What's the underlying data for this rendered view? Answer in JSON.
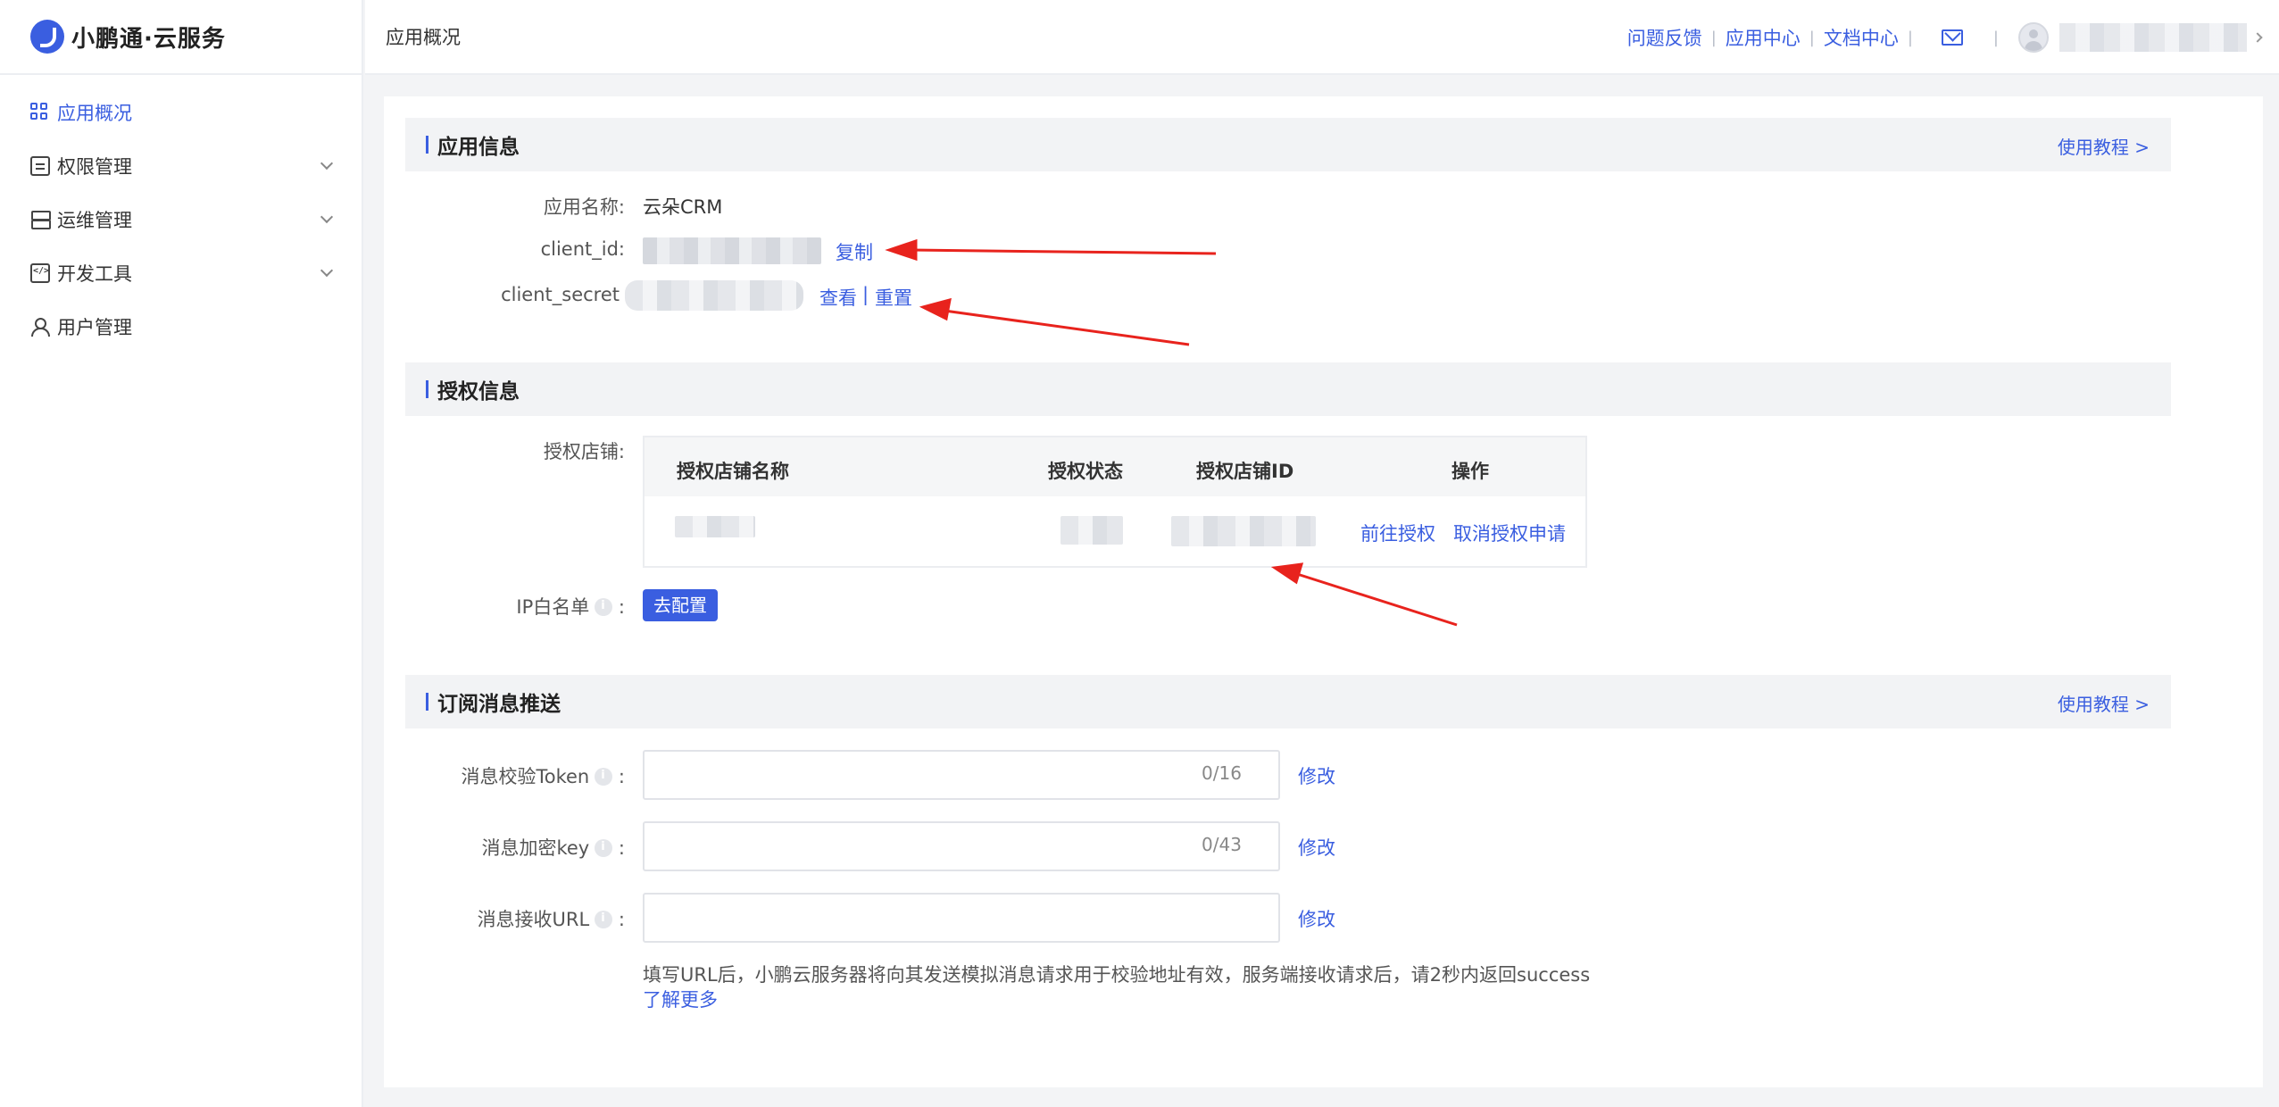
{
  "brand": {
    "name": "小鹏通·云服务"
  },
  "sidebar": {
    "items": [
      {
        "label": "应用概况",
        "icon": "grid-icon",
        "active": true
      },
      {
        "label": "权限管理",
        "icon": "document-icon",
        "expandable": true
      },
      {
        "label": "运维管理",
        "icon": "server-icon",
        "expandable": true
      },
      {
        "label": "开发工具",
        "icon": "code-icon",
        "expandable": true
      },
      {
        "label": "用户管理",
        "icon": "user-icon"
      }
    ]
  },
  "header": {
    "breadcrumb": "应用概况",
    "links": [
      "问题反馈",
      "应用中心",
      "文档中心"
    ]
  },
  "app_info": {
    "title": "应用信息",
    "tutorial": "使用教程 >",
    "name_label": "应用名称:",
    "name_value": "云朵CRM",
    "client_id_label": "client_id:",
    "copy": "复制",
    "client_secret_label": "client_secret",
    "view": "查看",
    "sep": "|",
    "reset": "重置"
  },
  "auth_info": {
    "title": "授权信息",
    "shop_label": "授权店铺:",
    "columns": [
      "授权店铺名称",
      "授权状态",
      "授权店铺ID",
      "操作"
    ],
    "actions": [
      "前往授权",
      "取消授权申请"
    ],
    "ip_label": "IP白名单",
    "colon": ":",
    "configure": "去配置"
  },
  "subscription": {
    "title": "订阅消息推送",
    "tutorial": "使用教程 >",
    "token_label": "消息校验Token",
    "token_count": "0/16",
    "key_label": "消息加密key",
    "key_count": "0/43",
    "url_label": "消息接收URL",
    "colon": ":",
    "modify": "修改",
    "hint": "填写URL后，小鹏云服务器将向其发送模拟消息请求用于校验地址有效，服务端接收请求后，请2秒内返回success",
    "learn_more": "了解更多"
  },
  "colors": {
    "accent": "#3a5ee0",
    "annotation": "#e8231d"
  }
}
